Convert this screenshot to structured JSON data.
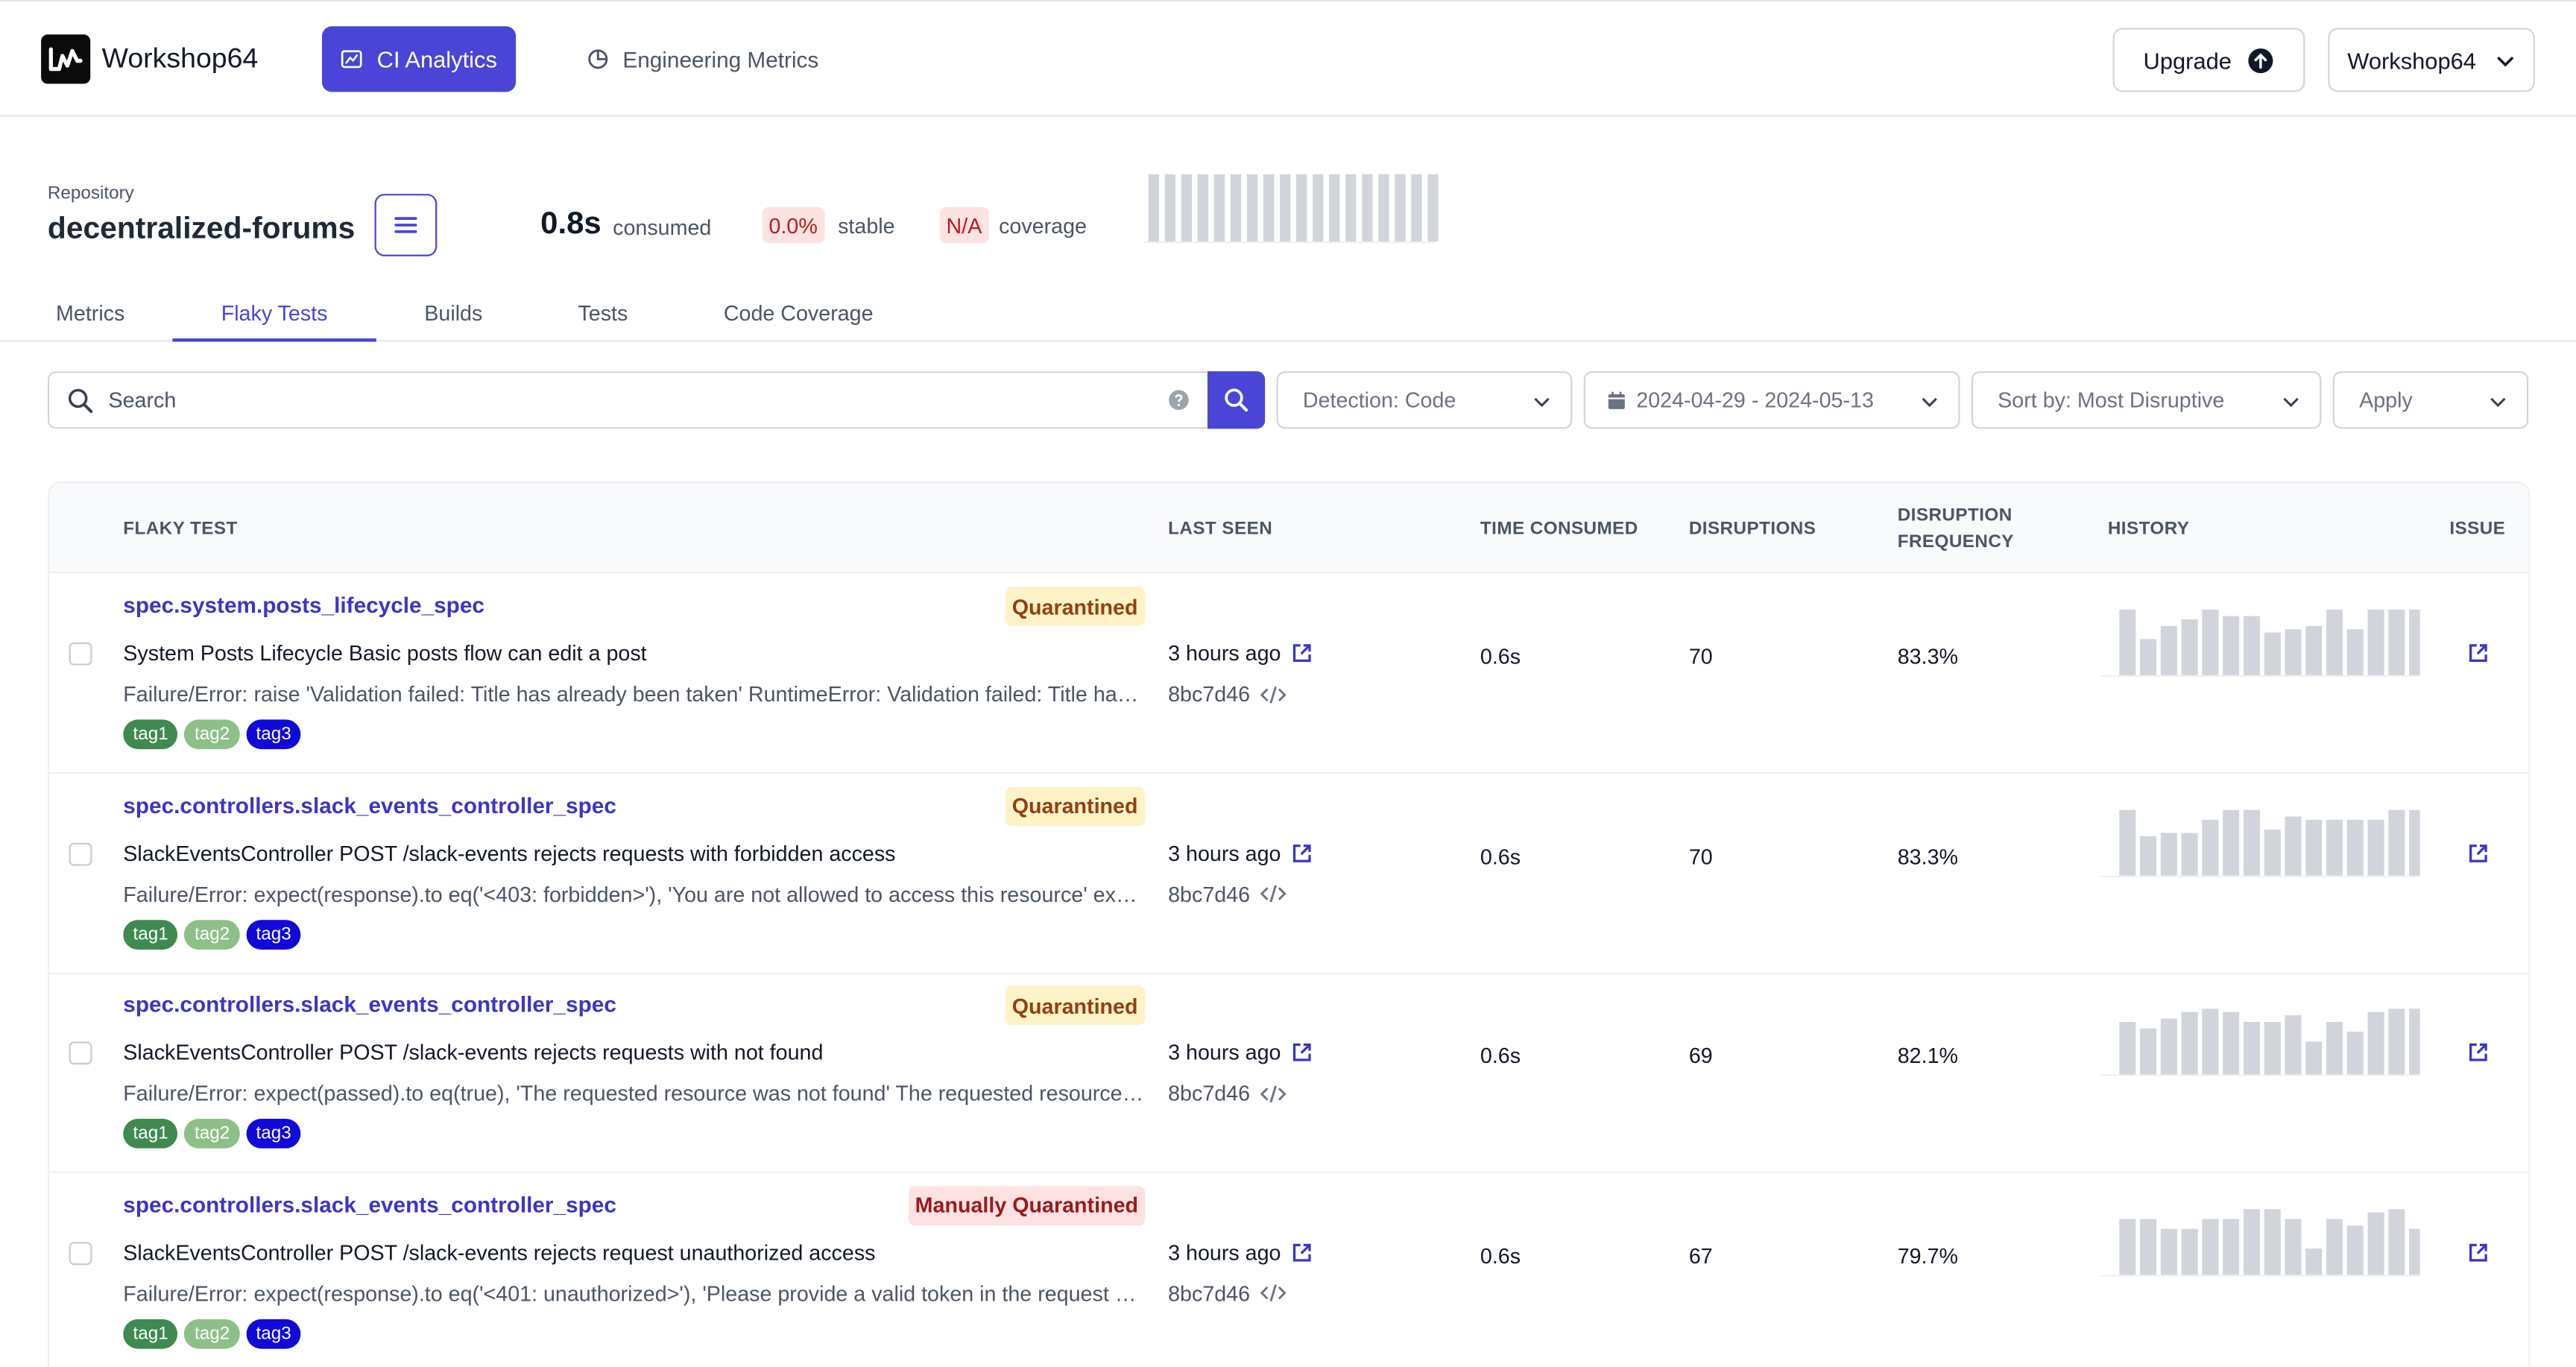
{
  "colors": {
    "accent": "#4a45d6",
    "link": "#3b35c8",
    "bar": "#d1d5db",
    "quarantined_bg": "#fef3c7",
    "manual_bg": "#fde2e2"
  },
  "nav": {
    "brand": "Workshop64",
    "tabs": [
      {
        "label": "CI Analytics",
        "icon": "analytics-icon",
        "active": true
      },
      {
        "label": "Engineering Metrics",
        "icon": "pie-chart-icon",
        "active": false
      }
    ],
    "upgrade_label": "Upgrade",
    "org_label": "Workshop64"
  },
  "repo": {
    "label": "Repository",
    "name": "decentralized-forums",
    "consumed_value": "0.8s",
    "consumed_label": "consumed",
    "stable_value": "0.0%",
    "stable_label": "stable",
    "coverage_value": "N/A",
    "coverage_label": "coverage",
    "sparkline_bar_count": 18
  },
  "tabs": [
    {
      "label": "Metrics",
      "active": false
    },
    {
      "label": "Flaky Tests",
      "active": true
    },
    {
      "label": "Builds",
      "active": false
    },
    {
      "label": "Tests",
      "active": false
    },
    {
      "label": "Code Coverage",
      "active": false
    }
  ],
  "filters": {
    "search_placeholder": "Search",
    "detection": "Detection: Code",
    "date_range": "2024-04-29 - 2024-05-13",
    "sort": "Sort by: Most Disruptive",
    "apply": "Apply"
  },
  "table": {
    "headers": {
      "flaky_test": "FLAKY TEST",
      "last_seen": "LAST SEEN",
      "time_consumed": "TIME CONSUMED",
      "disruptions": "DISRUPTIONS",
      "disruption_frequency_1": "DISRUPTION",
      "disruption_frequency_2": "FREQUENCY",
      "history": "HISTORY",
      "issue": "ISSUE"
    },
    "rows": [
      {
        "name": "spec.system.posts_lifecycle_spec",
        "status": "Quarantined",
        "description": "System Posts Lifecycle Basic posts flow can edit a post",
        "error": "Failure/Error: raise 'Validation failed: Title has already been taken' RuntimeError: Validation failed: Title has already been taken",
        "tags": [
          {
            "label": "tag1",
            "color": "#3e8a50"
          },
          {
            "label": "tag2",
            "color": "#8fbf88"
          },
          {
            "label": "tag3",
            "color": "#1009d8"
          }
        ],
        "last_seen": "3 hours ago",
        "sha": "8bc7d46",
        "time_consumed": "0.6s",
        "disruptions": "70",
        "frequency": "83.3%",
        "history": [
          1.0,
          0.55,
          0.75,
          0.85,
          1.0,
          0.9,
          0.9,
          0.65,
          0.7,
          0.75,
          1.0,
          0.7,
          1.0,
          1.0,
          1.0
        ]
      },
      {
        "name": "spec.controllers.slack_events_controller_spec",
        "status": "Quarantined",
        "description": "SlackEventsController POST /slack-events rejects requests with forbidden access",
        "error": "Failure/Error: expect(response).to eq('<403: forbidden>'), 'You are not allowed to access this resource' expected",
        "tags": [
          {
            "label": "tag1",
            "color": "#3e8a50"
          },
          {
            "label": "tag2",
            "color": "#8fbf88"
          },
          {
            "label": "tag3",
            "color": "#1009d8"
          }
        ],
        "last_seen": "3 hours ago",
        "sha": "8bc7d46",
        "time_consumed": "0.6s",
        "disruptions": "70",
        "frequency": "83.3%",
        "history": [
          1.0,
          0.6,
          0.65,
          0.65,
          0.85,
          1.0,
          1.0,
          0.7,
          0.9,
          0.85,
          0.85,
          0.85,
          0.85,
          1.0,
          1.0
        ]
      },
      {
        "name": "spec.controllers.slack_events_controller_spec",
        "status": "Quarantined",
        "description": "SlackEventsController POST /slack-events rejects requests with not found",
        "error": "Failure/Error: expect(passed).to eq(true), 'The requested resource was not found' The requested resource was not found",
        "tags": [
          {
            "label": "tag1",
            "color": "#3e8a50"
          },
          {
            "label": "tag2",
            "color": "#8fbf88"
          },
          {
            "label": "tag3",
            "color": "#1009d8"
          }
        ],
        "last_seen": "3 hours ago",
        "sha": "8bc7d46",
        "time_consumed": "0.6s",
        "disruptions": "69",
        "frequency": "82.1%",
        "history": [
          0.8,
          0.7,
          0.85,
          0.95,
          1.0,
          0.95,
          0.8,
          0.8,
          0.9,
          0.5,
          0.8,
          0.65,
          0.95,
          1.0,
          1.0
        ]
      },
      {
        "name": "spec.controllers.slack_events_controller_spec",
        "status": "Manually Quarantined",
        "description": "SlackEventsController POST /slack-events rejects request unauthorized access",
        "error": "Failure/Error: expect(response).to eq('<401: unauthorized>'), 'Please provide a valid token in the request header'",
        "tags": [
          {
            "label": "tag1",
            "color": "#3e8a50"
          },
          {
            "label": "tag2",
            "color": "#8fbf88"
          },
          {
            "label": "tag3",
            "color": "#1009d8"
          }
        ],
        "last_seen": "3 hours ago",
        "sha": "8bc7d46",
        "time_consumed": "0.6s",
        "disruptions": "67",
        "frequency": "79.7%",
        "history": [
          0.85,
          0.85,
          0.7,
          0.7,
          0.85,
          0.85,
          1.0,
          1.0,
          0.85,
          0.4,
          0.85,
          0.75,
          0.95,
          1.0,
          0.7
        ]
      }
    ]
  }
}
